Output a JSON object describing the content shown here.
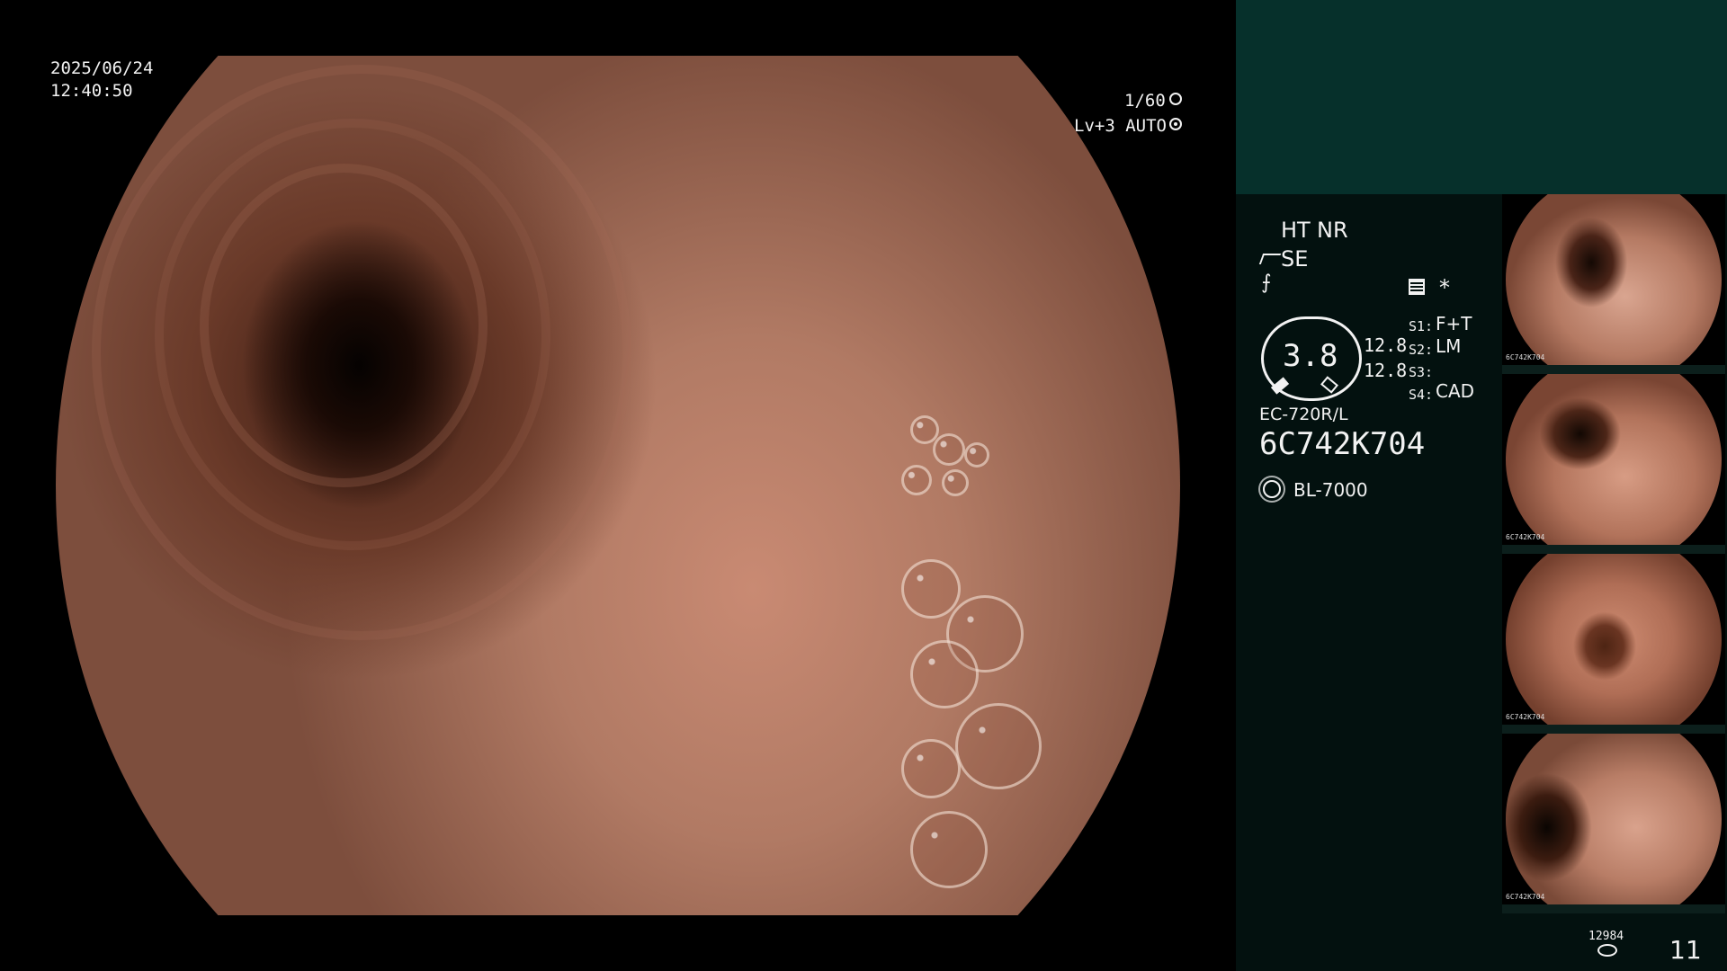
{
  "overlay": {
    "date": "2025/06/24",
    "time": "12:40:50",
    "shutter": "1/60",
    "level": "Lv+3 AUTO",
    "shutter_icon": "aperture-icon",
    "auto_icon": "iris-icon"
  },
  "panel": {
    "ht": "HT",
    "nr": "NR",
    "se": "SE",
    "se_icon": "scope-tip-icon",
    "f_icon": "filter-icon",
    "memory_icon": "memory-icon",
    "asterisk": "*",
    "gauge_value": "3.8",
    "gauge_top": "12.8",
    "gauge_bottom": "12.8",
    "s1_label": "S1:",
    "s1_value": "F+T",
    "s2_label": "S2:",
    "s2_value": "LM",
    "s3_label": "S3:",
    "s3_value": "",
    "s4_label": "S4:",
    "s4_value": "CAD",
    "scope_model": "EC-720R/L",
    "scope_serial": "6C742K704",
    "light_icon": "light-source-icon",
    "light_source": "BL-7000",
    "counter_top": "12984",
    "counter_icon": "storage-icon",
    "image_count": "11"
  },
  "thumbnails": [
    {
      "label": "6C742K704"
    },
    {
      "label": "6C742K704"
    },
    {
      "label": "6C742K704"
    },
    {
      "label": "6C742K704"
    }
  ],
  "colors": {
    "accent_yellow": "#f2b84a",
    "panel_top": "#06302b",
    "panel_bottom": "#03110f"
  }
}
